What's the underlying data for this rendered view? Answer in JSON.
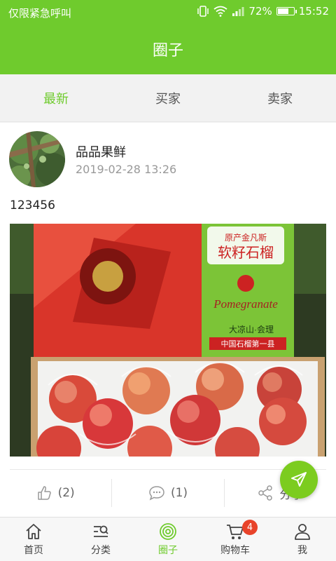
{
  "status_bar": {
    "carrier": "仅限紧急呼叫",
    "battery": "72%",
    "battery_level": 0.72,
    "time": "15:52"
  },
  "header": {
    "title": "圈子"
  },
  "tabs": [
    {
      "label": "最新",
      "active": true
    },
    {
      "label": "买家",
      "active": false
    },
    {
      "label": "卖家",
      "active": false
    }
  ],
  "post": {
    "author": "品品果鲜",
    "timestamp": "2019-02-28 13:26",
    "content": "123456",
    "box_text": {
      "line1": "原产金凡斯",
      "line2": "软籽石榴",
      "script": "Pomegranate",
      "origin": "大凉山·会理",
      "slogan": "中国石榴第一县"
    },
    "likes": "(2)",
    "comments": "(1)",
    "share": "分享"
  },
  "bottom_nav": [
    {
      "label": "首页",
      "icon": "home-icon",
      "active": false
    },
    {
      "label": "分类",
      "icon": "category-search-icon",
      "active": false
    },
    {
      "label": "圈子",
      "icon": "circle-icon",
      "active": true
    },
    {
      "label": "购物车",
      "icon": "cart-icon",
      "active": false,
      "badge": "4"
    },
    {
      "label": "我",
      "icon": "user-icon",
      "active": false
    }
  ],
  "colors": {
    "brand": "#6fcb2d",
    "badge": "#e8432a"
  }
}
